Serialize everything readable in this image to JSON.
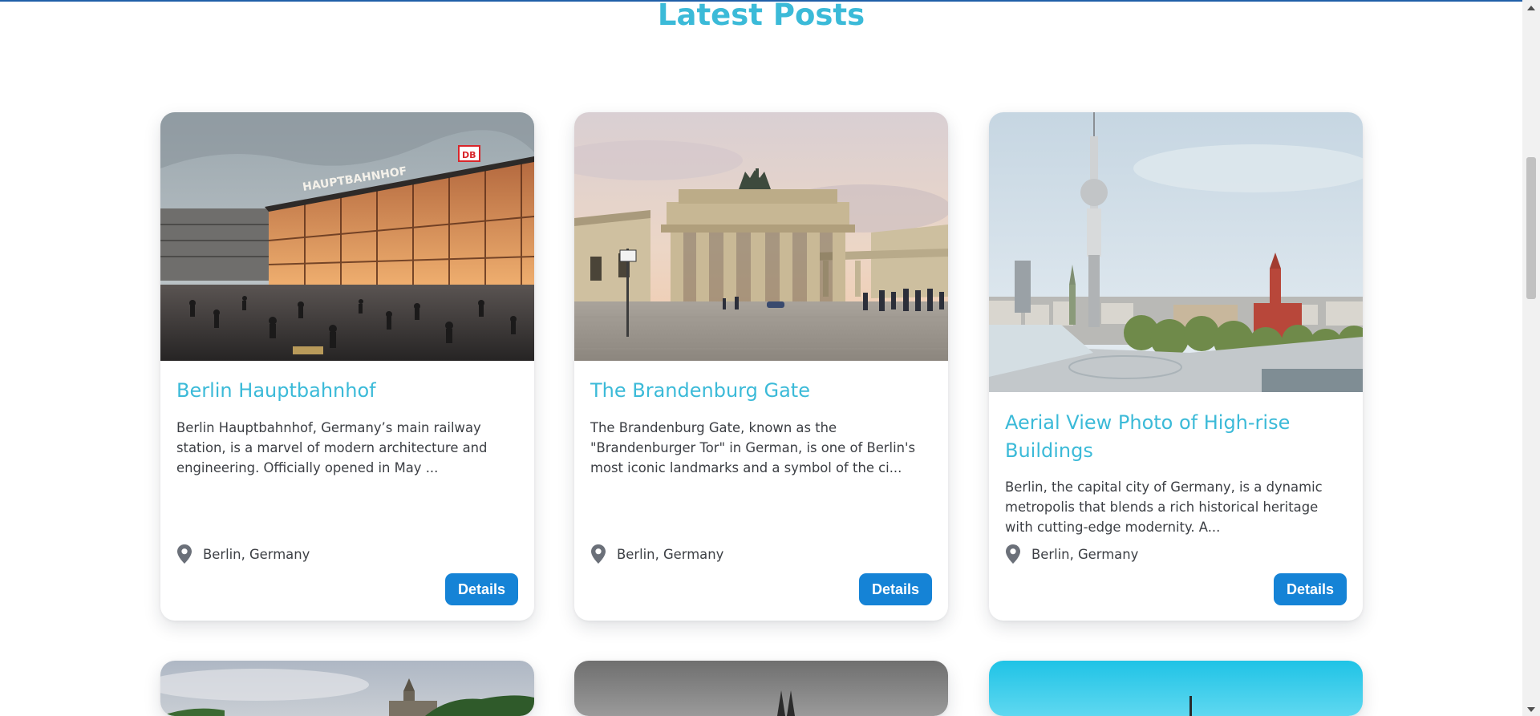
{
  "section": {
    "title": "Latest Posts"
  },
  "posts": [
    {
      "title": "Berlin Hauptbahnhof",
      "description": "Berlin Hauptbahnhof, Germany’s main railway station, is a marvel of modern architecture and engineering. Officially opened in May ...",
      "location": "Berlin, Germany",
      "button": "Details",
      "sign_text": "HAUPTBAHNHOF",
      "badge_text": "DB"
    },
    {
      "title": "The Brandenburg Gate",
      "description": "The Brandenburg Gate, known as the \"Brandenburger Tor\" in German, is one of Berlin's most iconic landmarks and a symbol of the ci...",
      "location": "Berlin, Germany",
      "button": "Details"
    },
    {
      "title": "Aerial View Photo of High-rise Buildings",
      "description": "Berlin, the capital city of Germany, is a dynamic metropolis that blends a rich historical heritage with cutting-edge modernity. A...",
      "location": "Berlin, Germany",
      "button": "Details"
    }
  ],
  "icons": {
    "location": "map-pin-icon",
    "scroll_up": "scroll-up-arrow-icon",
    "scroll_down": "scroll-down-arrow-icon"
  },
  "colors": {
    "accent": "#3bbad8",
    "button": "#1583d6",
    "text": "#3c3f44",
    "top_line": "#1f5fa8"
  }
}
